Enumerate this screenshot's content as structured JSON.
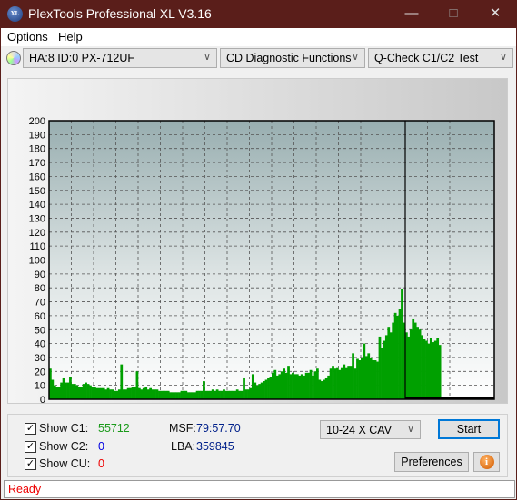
{
  "window": {
    "title": "PlexTools Professional XL V3.16",
    "icon_text": "XL"
  },
  "menu": [
    {
      "label": "Options"
    },
    {
      "label": "Help"
    }
  ],
  "toolbar": {
    "drive": "HA:8 ID:0  PX-712UF",
    "function": "CD Diagnostic Functions",
    "test": "Q-Check C1/C2 Test"
  },
  "chart_data": {
    "type": "bar",
    "xlim": [
      0,
      100
    ],
    "ylim": [
      0,
      200
    ],
    "x_ticks": [
      0,
      5,
      10,
      15,
      20,
      25,
      30,
      35,
      40,
      45,
      50,
      55,
      60,
      65,
      70,
      75,
      80,
      85,
      90,
      95,
      100
    ],
    "y_ticks": [
      0,
      10,
      20,
      30,
      40,
      50,
      60,
      70,
      80,
      90,
      100,
      110,
      120,
      130,
      140,
      150,
      160,
      170,
      180,
      190,
      200
    ],
    "grid": true,
    "end_marker_x": 80,
    "series": [
      {
        "color": "#00a000",
        "x_step": 0.5,
        "values": [
          22,
          14,
          10,
          9,
          9,
          12,
          15,
          12,
          12,
          16,
          11,
          11,
          10,
          9,
          9,
          11,
          12,
          11,
          10,
          9,
          9,
          8,
          8,
          8,
          8,
          7,
          8,
          7,
          7,
          6,
          6,
          7,
          25,
          7,
          7,
          8,
          8,
          9,
          9,
          20,
          8,
          7,
          8,
          9,
          7,
          8,
          7,
          7,
          7,
          6,
          6,
          6,
          6,
          6,
          5,
          5,
          5,
          5,
          5,
          6,
          6,
          6,
          5,
          5,
          5,
          5,
          6,
          6,
          6,
          13,
          6,
          6,
          6,
          7,
          6,
          7,
          6,
          6,
          7,
          6,
          6,
          6,
          6,
          6,
          7,
          6,
          6,
          15,
          7,
          7,
          8,
          18,
          12,
          10,
          11,
          12,
          13,
          14,
          15,
          16,
          19,
          21,
          17,
          18,
          20,
          22,
          19,
          24,
          18,
          19,
          18,
          18,
          17,
          18,
          17,
          19,
          19,
          21,
          17,
          20,
          22,
          14,
          13,
          14,
          15,
          17,
          22,
          24,
          22,
          23,
          21,
          23,
          25,
          23,
          24,
          24,
          33,
          22,
          29,
          28,
          30,
          40,
          31,
          33,
          30,
          28,
          28,
          27,
          45,
          37,
          42,
          46,
          52,
          48,
          55,
          62,
          60,
          65,
          79,
          55,
          48,
          45,
          50,
          58,
          55,
          52,
          50,
          46,
          43,
          42,
          40,
          44,
          41,
          42,
          44,
          39
        ]
      }
    ]
  },
  "controls": {
    "show_c1_label": "Show C1:",
    "c1_value": "55712",
    "show_c2_label": "Show C2:",
    "c2_value": "0",
    "show_cu_label": "Show CU:",
    "cu_value": "0",
    "msf_label": "MSF:",
    "msf_value": "79:57.70",
    "lba_label": "LBA:",
    "lba_value": "359845",
    "speed": "10-24 X CAV",
    "start": "Start",
    "preferences": "Preferences"
  },
  "status": "Ready"
}
